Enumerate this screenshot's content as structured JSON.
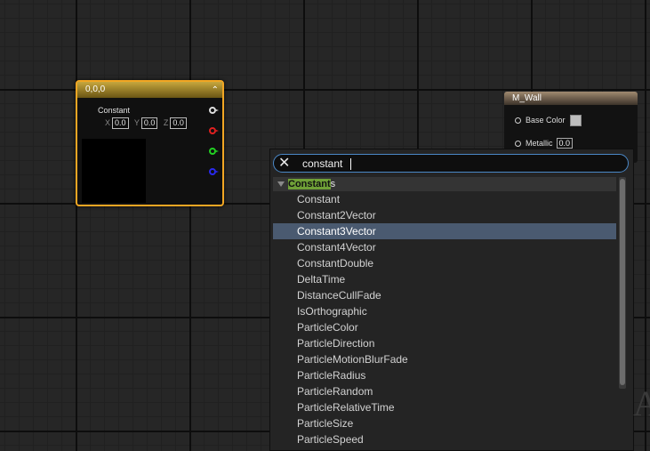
{
  "constant_node": {
    "title": "0,0,0",
    "label": "Constant",
    "x_label": "X",
    "x_value": "0.0",
    "y_label": "Y",
    "y_value": "0.0",
    "z_label": "Z",
    "z_value": "0.0"
  },
  "material_node": {
    "title": "M_Wall",
    "base_color_label": "Base Color",
    "metallic_label": "Metallic",
    "metallic_value": "0.0"
  },
  "search_popup": {
    "query": "constant",
    "category_highlight": "Constant",
    "category_rest": "s",
    "selected_index": 2,
    "items": [
      "Constant",
      "Constant2Vector",
      "Constant3Vector",
      "Constant4Vector",
      "ConstantDouble",
      "DeltaTime",
      "DistanceCullFade",
      "IsOrthographic",
      "ParticleColor",
      "ParticleDirection",
      "ParticleMotionBlurFade",
      "ParticleRadius",
      "ParticleRandom",
      "ParticleRelativeTime",
      "ParticleSize",
      "ParticleSpeed"
    ]
  },
  "colors": {
    "node_outline": "#f2a623",
    "selection": "#4a5a70",
    "search_border": "#4a88c7",
    "match_highlight": "#6fa037"
  }
}
